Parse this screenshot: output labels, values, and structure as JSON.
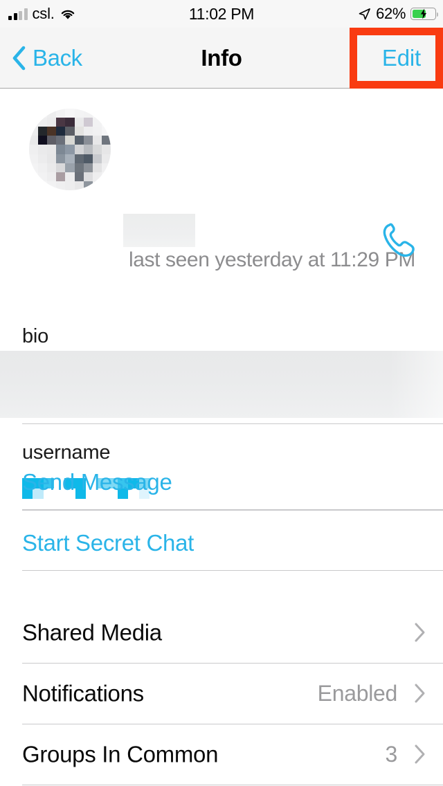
{
  "status_bar": {
    "carrier": "csl.",
    "time": "11:02 PM",
    "battery_percent": "62%",
    "signal_icon": "signal-bars-icon",
    "wifi_icon": "wifi-icon",
    "location_icon": "location-arrow-icon",
    "battery_icon": "battery-charging-icon",
    "battery_level": 55,
    "battery_charging": true,
    "signal_strength": 2,
    "signal_total": 4
  },
  "nav": {
    "back_label": "Back",
    "back_icon": "chevron-left-icon",
    "title": "Info",
    "edit_label": "Edit",
    "highlight_color": "#f93b11"
  },
  "profile": {
    "avatar": "avatar-pixelated",
    "name_redacted": true,
    "last_seen": "last seen yesterday at 11:29 PM",
    "call_icon": "phone-call-icon"
  },
  "bio": {
    "label": "bio",
    "value_redacted": true
  },
  "username": {
    "label": "username",
    "value_redacted": true
  },
  "actions": [
    {
      "label": "Send Message",
      "name": "send-message-button"
    },
    {
      "label": "Start Secret Chat",
      "name": "start-secret-chat-button"
    }
  ],
  "list": [
    {
      "title": "Shared Media",
      "value": "",
      "name": "shared-media-row"
    },
    {
      "title": "Notifications",
      "value": "Enabled",
      "name": "notifications-row"
    },
    {
      "title": "Groups In Common",
      "value": "3",
      "name": "groups-in-common-row"
    }
  ],
  "colors": {
    "accent": "#2ab4e8",
    "highlight": "#f93b11",
    "battery_green": "#3ad14e",
    "secondary_text": "#8c8c8e"
  }
}
